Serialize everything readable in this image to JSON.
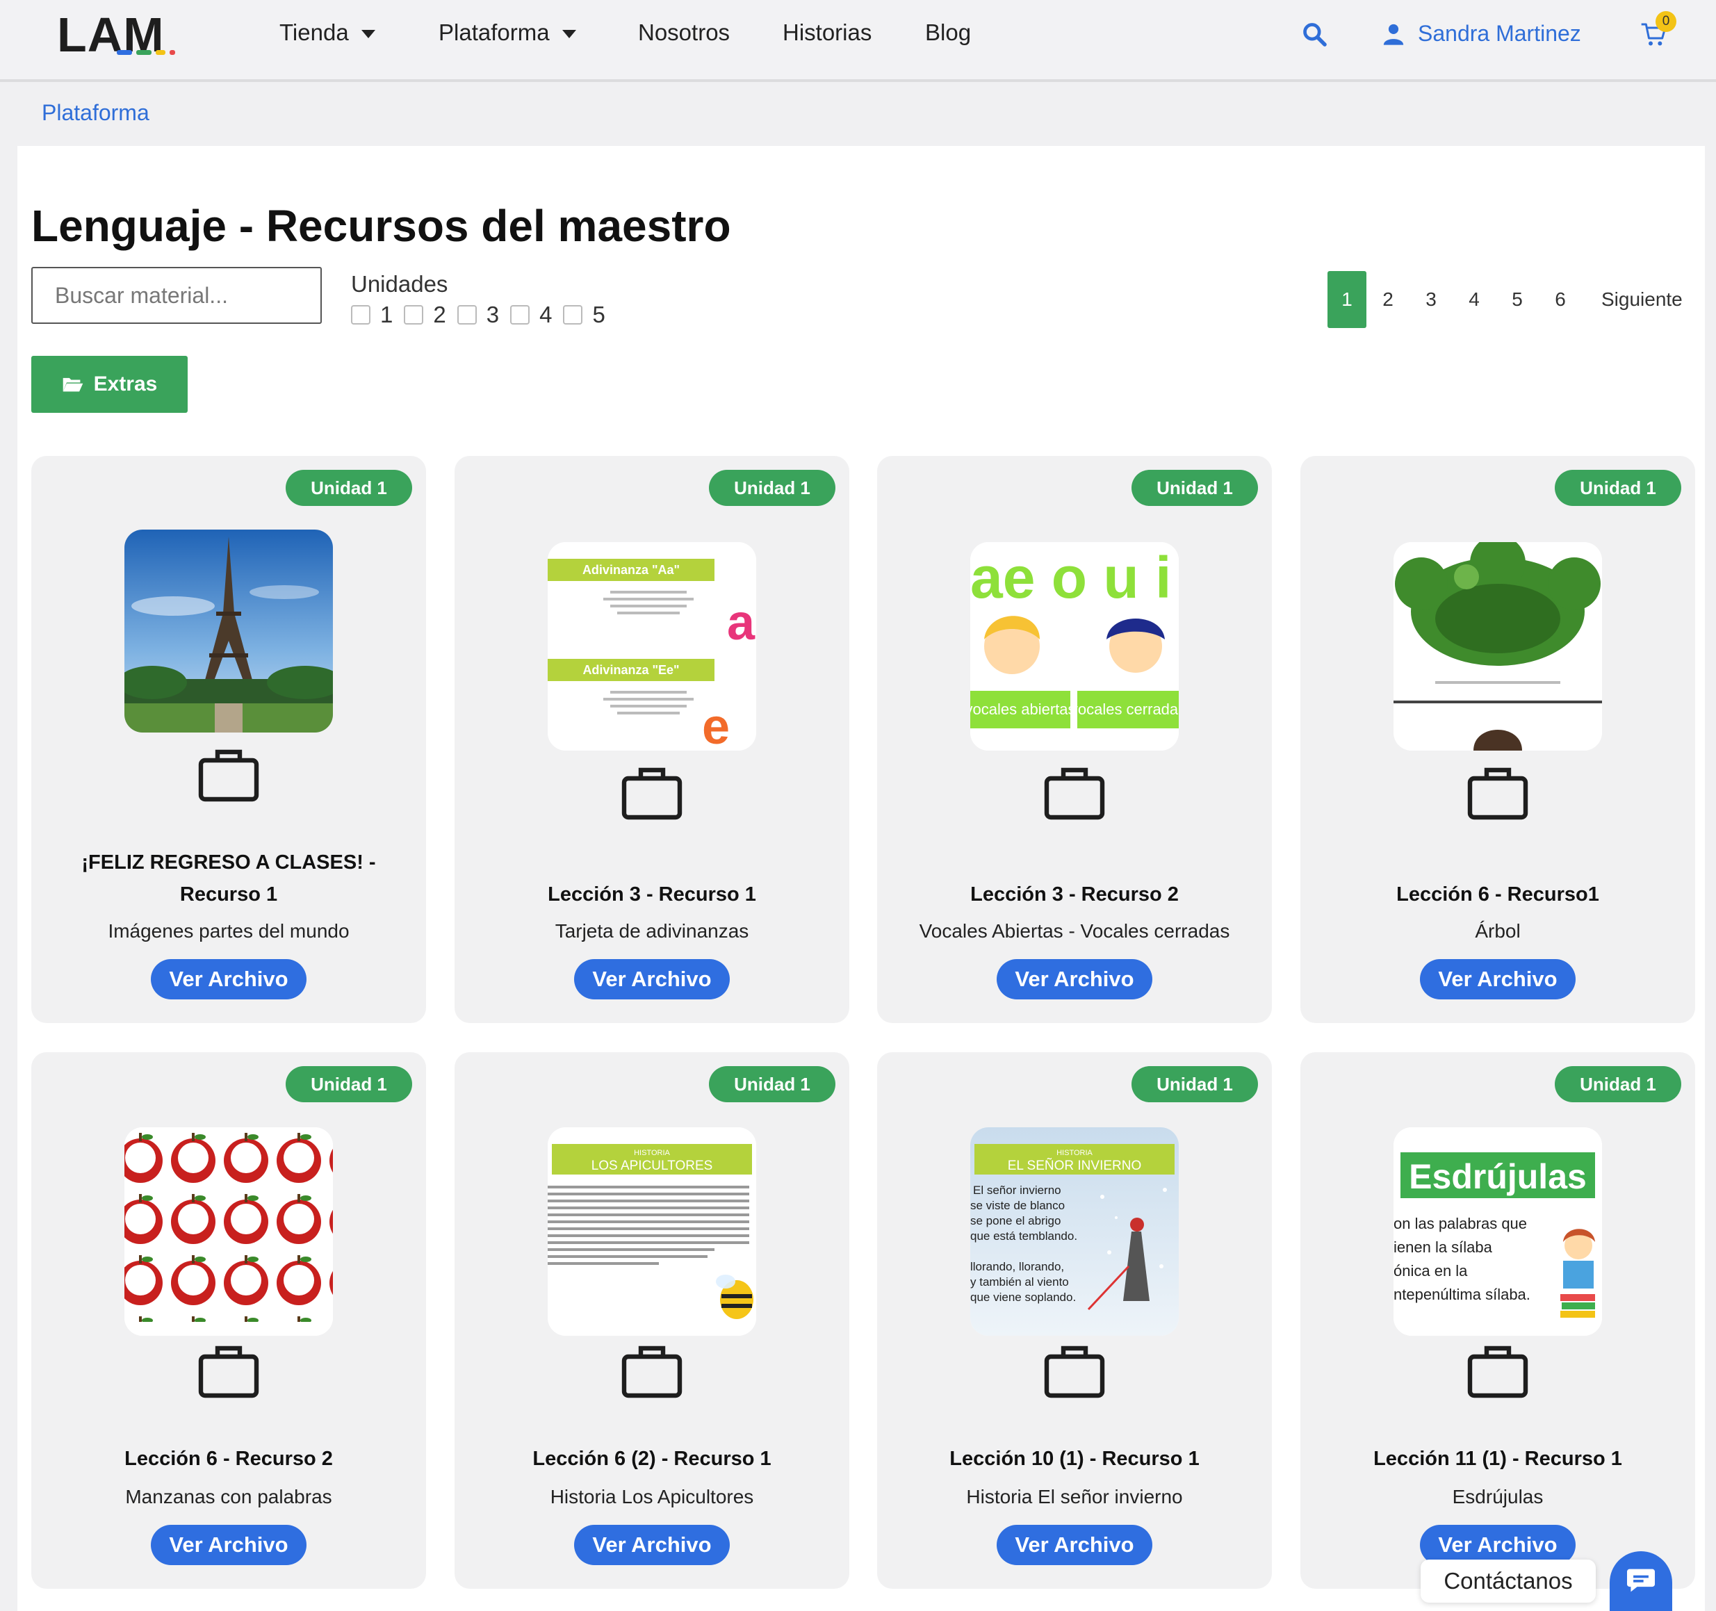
{
  "header": {
    "logo": "LAM",
    "nav": [
      "Tienda",
      "Plataforma",
      "Nosotros",
      "Historias",
      "Blog"
    ],
    "user_name": "Sandra Martinez",
    "cart_count": "0"
  },
  "breadcrumb": "Plataforma",
  "page_title": "Lenguaje - Recursos del maestro",
  "search": {
    "placeholder": "Buscar material..."
  },
  "units": {
    "label": "Unidades",
    "options": [
      "1",
      "2",
      "3",
      "4",
      "5"
    ]
  },
  "pagination": {
    "pages": [
      "1",
      "2",
      "3",
      "4",
      "5",
      "6"
    ],
    "active": "1",
    "next": "Siguiente"
  },
  "extras_label": "Extras",
  "cards": [
    {
      "badge": "Unidad 1",
      "title_line1": "¡FELIZ REGRESO A CLASES! -",
      "title_line2": "Recurso 1",
      "subtitle": "Imágenes partes del mundo",
      "button": "Ver Archivo"
    },
    {
      "badge": "Unidad 1",
      "title_line1": "Lección 3 - Recurso 1",
      "subtitle": "Tarjeta de adivinanzas",
      "button": "Ver Archivo"
    },
    {
      "badge": "Unidad 1",
      "title_line1": "Lección 3 - Recurso 2",
      "subtitle": "Vocales Abiertas - Vocales cerradas",
      "button": "Ver Archivo"
    },
    {
      "badge": "Unidad 1",
      "title_line1": "Lección 6 - Recurso1",
      "subtitle": "Árbol",
      "button": "Ver Archivo"
    },
    {
      "badge": "Unidad 1",
      "title_line1": "Lección 6 - Recurso 2",
      "subtitle": "Manzanas con palabras",
      "button": "Ver Archivo"
    },
    {
      "badge": "Unidad 1",
      "title_line1": "Lección 6 (2) - Recurso 1",
      "subtitle": "Historia Los Apicultores",
      "button": "Ver Archivo"
    },
    {
      "badge": "Unidad 1",
      "title_line1": "Lección 10 (1) - Recurso 1",
      "subtitle": "Historia El señor invierno",
      "button": "Ver Archivo"
    },
    {
      "badge": "Unidad 1",
      "title_line1": "Lección 11 (1) - Recurso 1",
      "subtitle": "Esdrújulas",
      "button": "Ver Archivo"
    }
  ],
  "thumb_text": {
    "adivinanza_a": "Adivinanza \"Aa\"",
    "adivinanza_e": "Adivinanza \"Ee\"",
    "letter_a": "a",
    "letter_e": "e",
    "vowels_top": "ae o u i",
    "vocales_abiertas": "vocales abiertas",
    "vocales_cerradas": "vocales cerradas",
    "historia": "HISTORIA",
    "apicultores": "LOS APICULTORES",
    "senor_invierno": "EL SEÑOR INVIERNO",
    "invierno_lines": [
      "El señor invierno",
      "se viste de blanco",
      "se pone el abrigo",
      "que está temblando.",
      "llorando, llorando,",
      "y también al viento",
      "que viene soplando."
    ],
    "esdrujulas": "Esdrújulas",
    "esdrujulas_lines": [
      "on las palabras que",
      "ienen la sílaba",
      "ónica en la",
      "ntepenúltima sílaba."
    ]
  },
  "contact_label": "Contáctanos",
  "colors": {
    "green": "#3aa35b",
    "blue": "#2f6ee0",
    "link": "#2f6ed8",
    "badge_yellow": "#f3c316"
  }
}
